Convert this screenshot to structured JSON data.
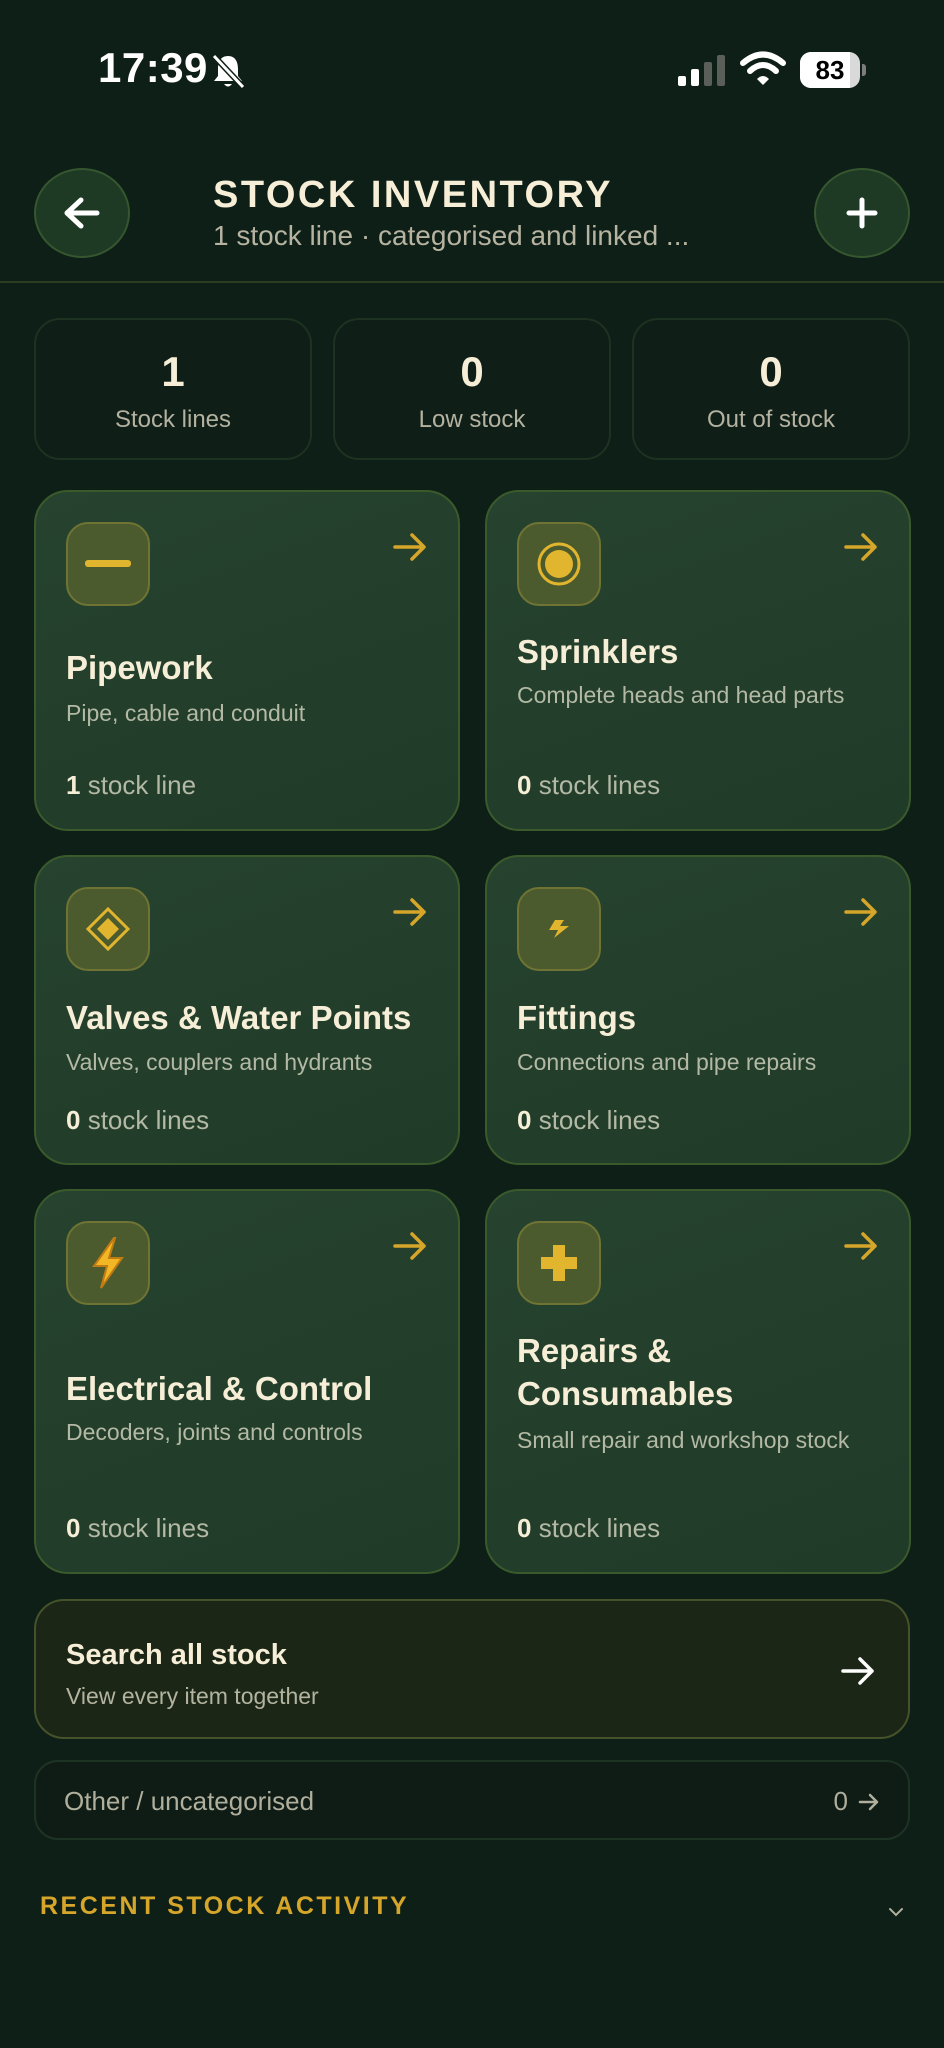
{
  "status_bar": {
    "time": "17:39",
    "battery": "83",
    "battery_level": 0.83
  },
  "header": {
    "title": "STOCK INVENTORY",
    "subtitle": "1 stock line · categorised and linked ..."
  },
  "stats": [
    {
      "value": "1",
      "label": "Stock lines"
    },
    {
      "value": "0",
      "label": "Low stock"
    },
    {
      "value": "0",
      "label": "Out of stock"
    }
  ],
  "categories": [
    {
      "icon": "dash-icon",
      "title": "Pipework",
      "description": "Pipe, cable and conduit",
      "count": "1",
      "count_suffix": "stock line"
    },
    {
      "icon": "target-icon",
      "title": "Sprinklers",
      "description": "Complete heads and head parts",
      "count": "0",
      "count_suffix": "stock lines"
    },
    {
      "icon": "diamond-icon",
      "title": "Valves & Water Points",
      "description": "Valves, couplers and hydrants",
      "count": "0",
      "count_suffix": "stock lines"
    },
    {
      "icon": "bolt-small-icon",
      "title": "Fittings",
      "description": "Connections and pipe repairs",
      "count": "0",
      "count_suffix": "stock lines"
    },
    {
      "icon": "lightning-icon",
      "title": "Electrical & Control",
      "description": "Decoders, joints and controls",
      "count": "0",
      "count_suffix": "stock lines"
    },
    {
      "icon": "cross-icon",
      "title": "Repairs & Consumables",
      "description": "Small repair and workshop stock",
      "count": "0",
      "count_suffix": "stock lines"
    }
  ],
  "search_all": {
    "title": "Search all stock",
    "subtitle": "View every item together"
  },
  "other": {
    "label": "Other / uncategorised",
    "count": "0"
  },
  "recent": {
    "title": "RECENT STOCK ACTIVITY"
  },
  "colors": {
    "accent": "#d6a62a",
    "background": "#0e1f17",
    "card": "#24412c"
  }
}
